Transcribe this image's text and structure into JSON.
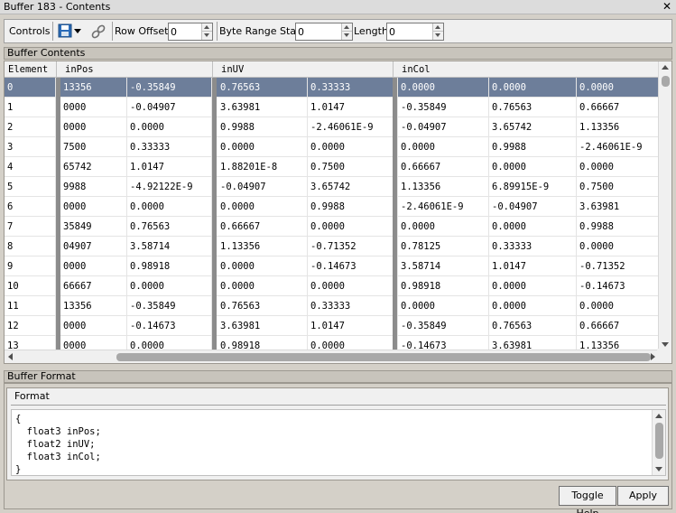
{
  "window": {
    "title": "Buffer 183 - Contents",
    "close_glyph": "✕"
  },
  "toolbar": {
    "controls_label": "Controls",
    "save_icon": "save-icon",
    "link_icon": "link-icon",
    "row_offset_label": "Row Offset",
    "row_offset_value": "0",
    "byte_range_label": "Byte Range Start",
    "byte_range_value": "0",
    "length_label": "Length",
    "length_value": "0"
  },
  "buffer_contents": {
    "title": "Buffer Contents",
    "columns": [
      "Element",
      "inPos",
      "inUV",
      "inCol"
    ],
    "selected_row": 0,
    "rows": [
      [
        "0",
        "13356",
        "-0.35849",
        "0.76563",
        "0.33333",
        "0.0000",
        "0.0000",
        "0.0000"
      ],
      [
        "1",
        "0000",
        "-0.04907",
        "3.63981",
        "1.0147",
        "-0.35849",
        "0.76563",
        "0.66667"
      ],
      [
        "2",
        "0000",
        "0.0000",
        "0.9988",
        "-2.46061E-9",
        "-0.04907",
        "3.65742",
        "1.13356"
      ],
      [
        "3",
        "7500",
        "0.33333",
        "0.0000",
        "0.0000",
        "0.0000",
        "0.9988",
        "-2.46061E-9"
      ],
      [
        "4",
        "65742",
        "1.0147",
        "1.88201E-8",
        "0.7500",
        "0.66667",
        "0.0000",
        "0.0000"
      ],
      [
        "5",
        "9988",
        "-4.92122E-9",
        "-0.04907",
        "3.65742",
        "1.13356",
        "6.89915E-9",
        "0.7500"
      ],
      [
        "6",
        "0000",
        "0.0000",
        "0.0000",
        "0.9988",
        "-2.46061E-9",
        "-0.04907",
        "3.63981"
      ],
      [
        "7",
        "35849",
        "0.76563",
        "0.66667",
        "0.0000",
        "0.0000",
        "0.0000",
        "0.9988"
      ],
      [
        "8",
        "04907",
        "3.58714",
        "1.13356",
        "-0.71352",
        "0.78125",
        "0.33333",
        "0.0000"
      ],
      [
        "9",
        "0000",
        "0.98918",
        "0.0000",
        "-0.14673",
        "3.58714",
        "1.0147",
        "-0.71352"
      ],
      [
        "10",
        "66667",
        "0.0000",
        "0.0000",
        "0.0000",
        "0.98918",
        "0.0000",
        "-0.14673"
      ],
      [
        "11",
        "13356",
        "-0.35849",
        "0.76563",
        "0.33333",
        "0.0000",
        "0.0000",
        "0.0000"
      ],
      [
        "12",
        "0000",
        "-0.14673",
        "3.63981",
        "1.0147",
        "-0.35849",
        "0.76563",
        "0.66667"
      ],
      [
        "13",
        "0000",
        "0.0000",
        "0.98918",
        "0.0000",
        "-0.14673",
        "3.63981",
        "1.13356"
      ]
    ]
  },
  "buffer_format": {
    "title": "Buffer Format",
    "format_label": "Format",
    "code_lines": [
      "{",
      "  float3 inPos;",
      "  float2 inUV;",
      "  float3 inCol;",
      "}"
    ]
  },
  "buttons": {
    "toggle_help": "Toggle Help",
    "apply": "Apply"
  },
  "colors": {
    "selection": "#6d7e9a",
    "background": "#d4d0c8"
  }
}
